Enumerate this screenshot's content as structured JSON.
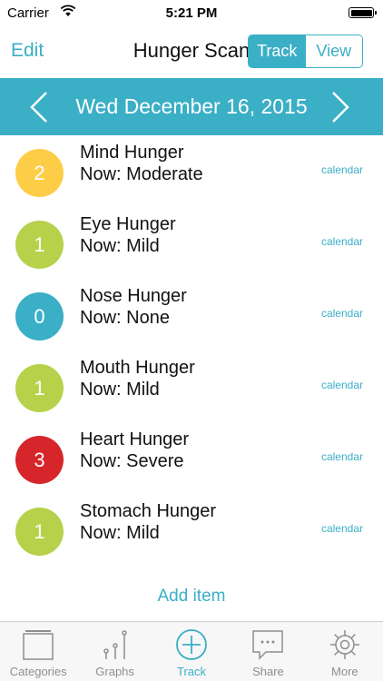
{
  "status": {
    "carrier": "Carrier",
    "time": "5:21 PM"
  },
  "nav": {
    "edit": "Edit",
    "title": "Hunger Scan",
    "segments": {
      "track": "Track",
      "view": "View"
    }
  },
  "date": {
    "label": "Wed December 16, 2015"
  },
  "items": [
    {
      "score": "2",
      "name": "Mind Hunger",
      "level": "Now: Moderate",
      "link": "calendar",
      "color": "#fecd48"
    },
    {
      "score": "1",
      "name": "Eye Hunger",
      "level": "Now: Mild",
      "link": "calendar",
      "color": "#b7d14a"
    },
    {
      "score": "0",
      "name": "Nose Hunger",
      "level": "Now: None",
      "link": "calendar",
      "color": "#3aafc6"
    },
    {
      "score": "1",
      "name": "Mouth Hunger",
      "level": "Now: Mild",
      "link": "calendar",
      "color": "#b7d14a"
    },
    {
      "score": "3",
      "name": "Heart Hunger",
      "level": "Now: Severe",
      "link": "calendar",
      "color": "#d7262b"
    },
    {
      "score": "1",
      "name": "Stomach Hunger",
      "level": "Now: Mild",
      "link": "calendar",
      "color": "#b7d14a"
    }
  ],
  "add_item": "Add item",
  "tabs": [
    {
      "label": "Categories",
      "icon": "categories-icon"
    },
    {
      "label": "Graphs",
      "icon": "graphs-icon"
    },
    {
      "label": "Track",
      "icon": "track-plus-icon"
    },
    {
      "label": "Share",
      "icon": "share-chat-icon"
    },
    {
      "label": "More",
      "icon": "gear-icon"
    }
  ],
  "colors": {
    "accent": "#3aafc6",
    "tab_inactive": "#8e8e93"
  }
}
